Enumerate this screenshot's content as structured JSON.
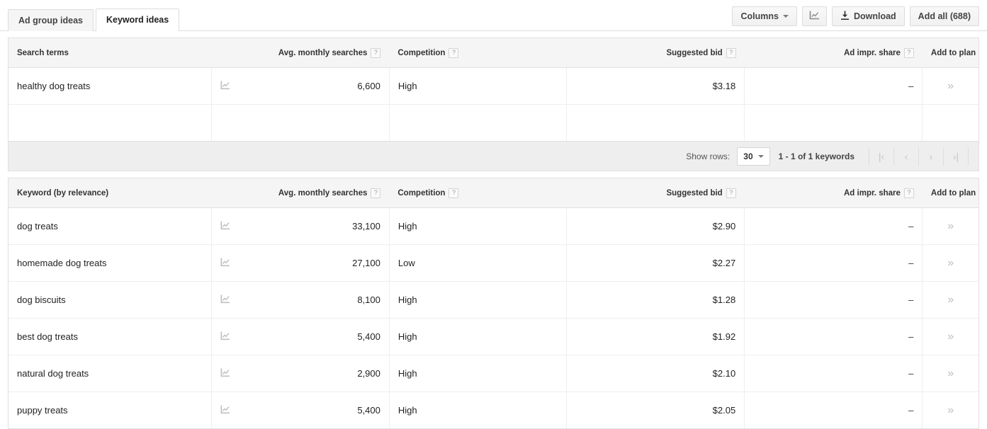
{
  "tabs": [
    {
      "label": "Ad group ideas",
      "active": false
    },
    {
      "label": "Keyword ideas",
      "active": true
    }
  ],
  "toolbar": {
    "columns_label": "Columns",
    "chart_icon": "line-chart-icon",
    "download_label": "Download",
    "download_icon": "download-icon",
    "add_all_label": "Add all (688)"
  },
  "search_terms_table": {
    "columns": {
      "term": "Search terms",
      "avg_searches": "Avg. monthly searches",
      "competition": "Competition",
      "suggested_bid": "Suggested bid",
      "ad_impr_share": "Ad impr. share",
      "add_to_plan": "Add to plan"
    },
    "help_marker": "?",
    "add_marker": "»",
    "rows": [
      {
        "term": "healthy dog treats",
        "avg_searches": "6,600",
        "competition": "High",
        "suggested_bid": "$3.18",
        "ad_impr_share": "–"
      }
    ],
    "footer": {
      "show_rows_label": "Show rows:",
      "rows_value": "30",
      "range_text": "1 - 1 of 1 keywords",
      "pager": [
        "|‹",
        "‹",
        "›",
        "›|"
      ]
    }
  },
  "keyword_ideas_table": {
    "columns": {
      "keyword": "Keyword (by relevance)",
      "avg_searches": "Avg. monthly searches",
      "competition": "Competition",
      "suggested_bid": "Suggested bid",
      "ad_impr_share": "Ad impr. share",
      "add_to_plan": "Add to plan"
    },
    "help_marker": "?",
    "add_marker": "»",
    "rows": [
      {
        "keyword": "dog treats",
        "avg_searches": "33,100",
        "competition": "High",
        "suggested_bid": "$2.90",
        "ad_impr_share": "–"
      },
      {
        "keyword": "homemade dog treats",
        "avg_searches": "27,100",
        "competition": "Low",
        "suggested_bid": "$2.27",
        "ad_impr_share": "–"
      },
      {
        "keyword": "dog biscuits",
        "avg_searches": "8,100",
        "competition": "High",
        "suggested_bid": "$1.28",
        "ad_impr_share": "–"
      },
      {
        "keyword": "best dog treats",
        "avg_searches": "5,400",
        "competition": "High",
        "suggested_bid": "$1.92",
        "ad_impr_share": "–"
      },
      {
        "keyword": "natural dog treats",
        "avg_searches": "2,900",
        "competition": "High",
        "suggested_bid": "$2.10",
        "ad_impr_share": "–"
      },
      {
        "keyword": "puppy treats",
        "avg_searches": "5,400",
        "competition": "High",
        "suggested_bid": "$2.05",
        "ad_impr_share": "–"
      }
    ]
  },
  "colors": {
    "header_bg": "#f5f5f5",
    "footer_bg": "#eeeeee",
    "border": "#e0e0e0",
    "text": "#222222",
    "muted": "#bdbdbd"
  }
}
